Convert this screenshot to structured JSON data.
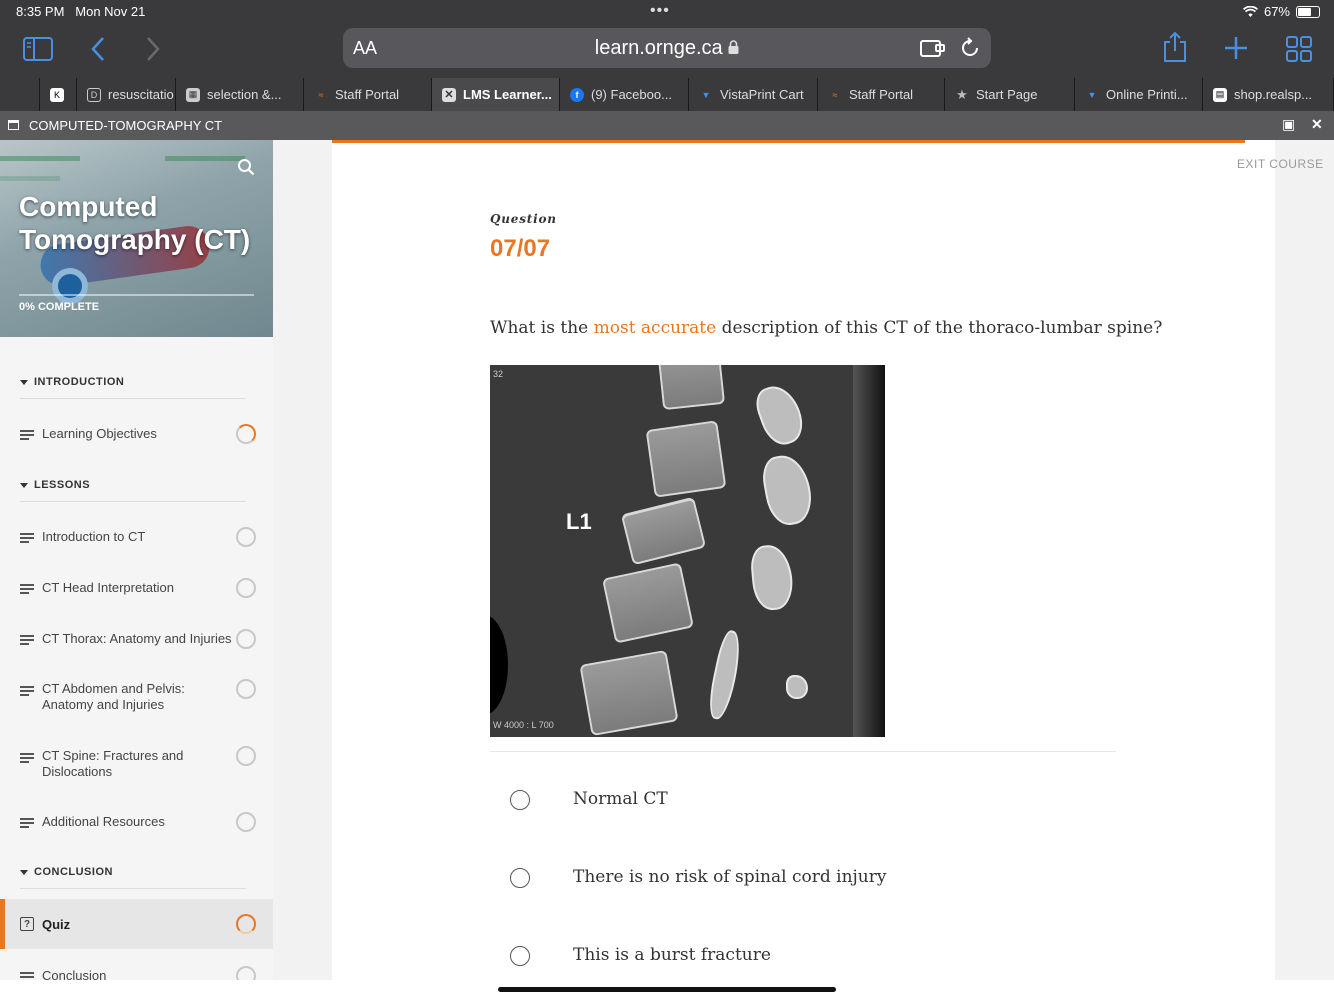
{
  "status": {
    "time": "8:35 PM",
    "date": "Mon Nov 21",
    "battery": "67%",
    "battery_level": 0.67
  },
  "browser": {
    "text_size": "AA",
    "url": "learn.ornge.ca",
    "tabs": [
      {
        "label": "resuscitatio"
      },
      {
        "label": "selection &..."
      },
      {
        "label": "Staff Portal"
      },
      {
        "label": "LMS Learner..."
      },
      {
        "label": "(9) Faceboo..."
      },
      {
        "label": "VistaPrint Cart"
      },
      {
        "label": "Staff Portal"
      },
      {
        "label": "Start Page"
      },
      {
        "label": "Online Printi..."
      },
      {
        "label": "shop.realsp..."
      }
    ]
  },
  "course_window": {
    "title": "COMPUTED-TOMOGRAPHY CT"
  },
  "sidebar": {
    "title": "Computed Tomography (CT)",
    "progress": "0% COMPLETE",
    "progress_value": 0,
    "sections": {
      "introduction": "INTRODUCTION",
      "lessons": "LESSONS",
      "conclusion": "CONCLUSION"
    },
    "items": {
      "learning_objectives": "Learning Objectives",
      "intro_ct": "Introduction to CT",
      "ct_head": "CT Head Interpretation",
      "ct_thorax": "CT Thorax: Anatomy and Injuries",
      "ct_abdomen": "CT Abdomen and Pelvis: Anatomy and Injuries",
      "ct_spine": "CT Spine: Fractures and Dislocations",
      "additional": "Additional Resources",
      "quiz": "Quiz",
      "conclusion": "Conclusion"
    }
  },
  "main": {
    "exit": "EXIT COURSE",
    "question_label": "Question",
    "question_number": "07/07",
    "question_pre": "What is the ",
    "question_highlight": "most accurate",
    "question_post": " description of this CT of the thoraco-lumbar spine?",
    "image": {
      "corner_top": "32",
      "corner_bottom": "W 4000 : L 700",
      "vertebra_label": "L1"
    },
    "options": [
      "Normal CT",
      "There is no risk of spinal cord injury",
      "This is a burst fracture"
    ]
  }
}
